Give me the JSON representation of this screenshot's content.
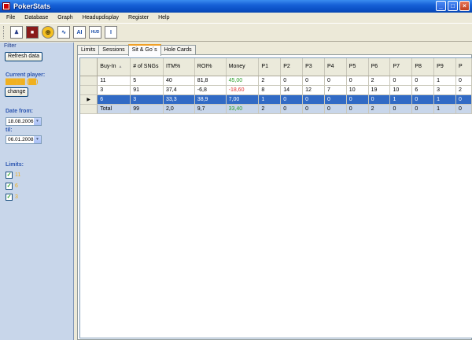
{
  "window": {
    "title": "PokerStats"
  },
  "menu": [
    "File",
    "Database",
    "Graph",
    "Headupdisplay",
    "Register",
    "Help"
  ],
  "toolbar": [
    {
      "icon": "player-icon",
      "glyph": "♟"
    },
    {
      "icon": "stop-icon",
      "glyph": "■"
    },
    {
      "icon": "chip-icon",
      "glyph": "◎"
    },
    {
      "icon": "graph-icon",
      "glyph": "∿"
    },
    {
      "icon": "ai-icon",
      "glyph": "AI"
    },
    {
      "icon": "hud-icon",
      "glyph": "HUD"
    },
    {
      "icon": "info-icon",
      "glyph": "I"
    }
  ],
  "left": {
    "filter_label": "Filter",
    "refresh_label": "Refresh data",
    "current_player_label": "Current player:",
    "player_name": "█████ (██)",
    "change_label": "change",
    "date_from_label": "Date from:",
    "date_from": "18.08.2006",
    "til_label": "til:",
    "date_til": "06.01.2008",
    "limits_label": "Limits:",
    "limits": [
      "11",
      "6",
      "3"
    ]
  },
  "tabs": [
    {
      "label": "Limits",
      "active": false
    },
    {
      "label": "Sessions",
      "active": false
    },
    {
      "label": "Sit & Go´s",
      "active": true
    },
    {
      "label": "Hole Cards",
      "active": false
    }
  ],
  "table": {
    "columns": [
      "Buy-In",
      "# of SNGs",
      "ITM%",
      "ROI%",
      "Money",
      "P1",
      "P2",
      "P3",
      "P4",
      "P5",
      "P6",
      "P7",
      "P8",
      "P9",
      "P"
    ],
    "rows": [
      {
        "cells": [
          "11",
          "5",
          "40",
          "81,8",
          "45,00",
          "2",
          "0",
          "0",
          "0",
          "0",
          "2",
          "0",
          "0",
          "1",
          "0"
        ],
        "money_color": "green",
        "state": ""
      },
      {
        "cells": [
          "3",
          "91",
          "37,4",
          "-6,8",
          "-18,60",
          "8",
          "14",
          "12",
          "7",
          "10",
          "19",
          "10",
          "6",
          "3",
          "2"
        ],
        "money_color": "red",
        "state": ""
      },
      {
        "cells": [
          "6",
          "3",
          "33,3",
          "38,9",
          "7,00",
          "1",
          "0",
          "0",
          "0",
          "0",
          "0",
          "1",
          "0",
          "1",
          "0"
        ],
        "money_color": "green",
        "state": "selected"
      },
      {
        "cells": [
          "Total",
          "99",
          "2,0",
          "9,7",
          "33,40",
          "2",
          "0",
          "0",
          "0",
          "0",
          "2",
          "0",
          "0",
          "1",
          "0"
        ],
        "money_color": "green",
        "state": "total"
      }
    ]
  }
}
